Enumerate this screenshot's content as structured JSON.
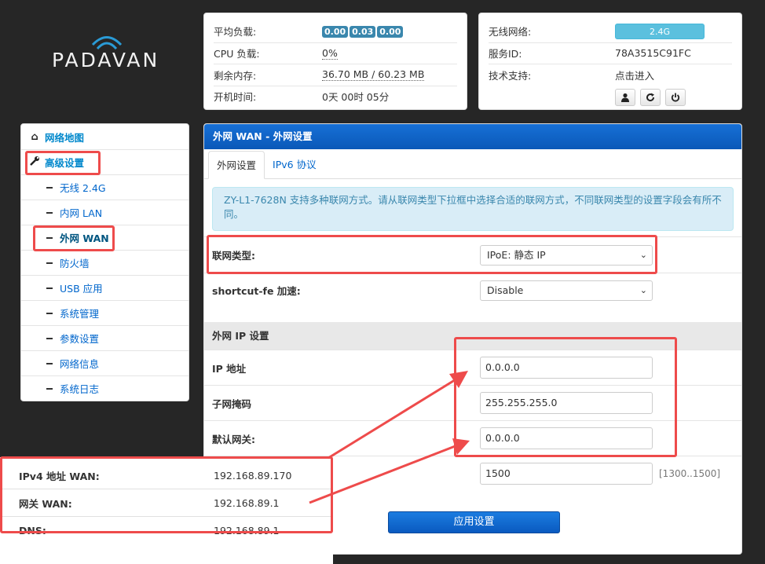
{
  "logo": {
    "text": "PADAVAN"
  },
  "status": {
    "rows": [
      {
        "label": "平均负载:",
        "values": [
          "0.00",
          "0.03",
          "0.00"
        ]
      },
      {
        "label": "CPU 负载:",
        "value": "0%"
      },
      {
        "label": "剩余内存:",
        "value": "36.70 MB / 60.23 MB"
      },
      {
        "label": "开机时间:",
        "value": "0天 00时 05分"
      }
    ]
  },
  "sysinfo": {
    "wireless_label": "无线网络:",
    "wireless_value": "2.4G",
    "service_label": "服务ID:",
    "service_value": "78A3515C91FC",
    "support_label": "技术支持:",
    "support_link": "点击进入",
    "buttons": [
      "user-icon",
      "refresh-icon",
      "power-icon"
    ]
  },
  "nav": {
    "items": [
      {
        "label": "网络地图",
        "icon": "home-icon",
        "level": "top"
      },
      {
        "label": "高级设置",
        "icon": "wrench-icon",
        "level": "top"
      },
      {
        "label": "无线 2.4G",
        "level": "sub"
      },
      {
        "label": "内网 LAN",
        "level": "sub"
      },
      {
        "label": "外网 WAN",
        "level": "sub",
        "active": true
      },
      {
        "label": "防火墙",
        "level": "sub"
      },
      {
        "label": "USB 应用",
        "level": "sub"
      },
      {
        "label": "系统管理",
        "level": "sub"
      },
      {
        "label": "参数设置",
        "level": "sub"
      },
      {
        "label": "网络信息",
        "level": "sub"
      },
      {
        "label": "系统日志",
        "level": "sub"
      }
    ]
  },
  "main": {
    "title": "外网 WAN - 外网设置",
    "tabs": [
      "外网设置",
      "IPv6 协议"
    ],
    "alert": "ZY-L1-7628N 支持多种联网方式。请从联网类型下拉框中选择合适的联网方式，不同联网类型的设置字段会有所不同。",
    "conn_type_label": "联网类型:",
    "conn_type_value": "IPoE: 静态 IP",
    "shortcut_label": "shortcut-fe 加速:",
    "shortcut_value": "Disable",
    "section_ip": "外网 IP 设置",
    "ip_label": "IP 地址",
    "ip_value": "0.0.0.0",
    "mask_label": "子网掩码",
    "mask_value": "255.255.255.0",
    "gw_label": "默认网关:",
    "gw_value": "0.0.0.0",
    "mtu_value": "1500",
    "mtu_hint": "[1300..1500]",
    "apply_label": "应用设置"
  },
  "overlay": {
    "rows": [
      {
        "label": "IPv4 地址 WAN:",
        "value": "192.168.89.170"
      },
      {
        "label": "网关 WAN:",
        "value": "192.168.89.1"
      },
      {
        "label": "DNS:",
        "value": "192.168.89.1"
      }
    ]
  },
  "colors": {
    "annotation_red": "#ee4b4b",
    "header_blue": "#0a58b8",
    "badge_blue": "#3a87ad"
  }
}
